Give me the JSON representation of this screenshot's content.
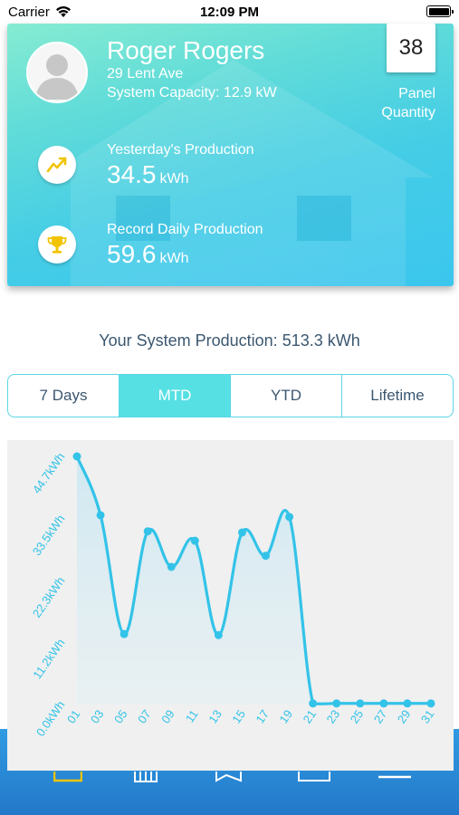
{
  "status_bar": {
    "carrier": "Carrier",
    "time": "12:09 PM"
  },
  "profile": {
    "name": "Roger Rogers",
    "address": "29 Lent Ave",
    "system_capacity": "System Capacity: 12.9 kW",
    "panel_count": "38",
    "panel_label_line1": "Panel",
    "panel_label_line2": "Quantity"
  },
  "stats": {
    "yesterday_label": "Yesterday's Production",
    "yesterday_value": "34.5",
    "yesterday_unit": "kWh",
    "record_label": "Record Daily Production",
    "record_value": "59.6",
    "record_unit": "kWh"
  },
  "summary_text": "Your System Production: 513.3 kWh",
  "tabs": [
    {
      "label": "7 Days",
      "active": false
    },
    {
      "label": "MTD",
      "active": true
    },
    {
      "label": "YTD",
      "active": false
    },
    {
      "label": "Lifetime",
      "active": false
    }
  ],
  "colors": {
    "accent": "#33c3e8",
    "active_tab": "#56e0e4",
    "card_gradient_start": "#86ecd2",
    "card_gradient_end": "#3bc6ee",
    "tab_bar": "#2a8ad6"
  },
  "chart_data": {
    "type": "line",
    "title": "",
    "xlabel": "",
    "ylabel": "",
    "x_tick_labels": [
      "01",
      "03",
      "05",
      "07",
      "09",
      "11",
      "13",
      "15",
      "17",
      "19",
      "21",
      "23",
      "25",
      "27",
      "29",
      "31"
    ],
    "y_tick_labels": [
      "0.0kWh",
      "11.2kWh",
      "22.3kWh",
      "33.5kWh",
      "44.7kWh"
    ],
    "ylim": [
      0,
      44.7
    ],
    "grid": false,
    "filled_area": true,
    "series": [
      {
        "x": [
          1,
          3,
          5,
          7,
          9,
          11,
          13,
          15,
          17,
          19,
          21,
          23,
          25,
          27,
          29,
          31
        ],
        "values": [
          44.7,
          34.1,
          12.7,
          31.2,
          24.8,
          29.5,
          12.5,
          31.0,
          26.8,
          33.8,
          0.2,
          0.2,
          0.2,
          0.2,
          0.2,
          0.2
        ]
      }
    ]
  },
  "icons": {
    "trend": "trend-up-icon",
    "trophy": "trophy-icon",
    "avatar": "person-icon"
  }
}
